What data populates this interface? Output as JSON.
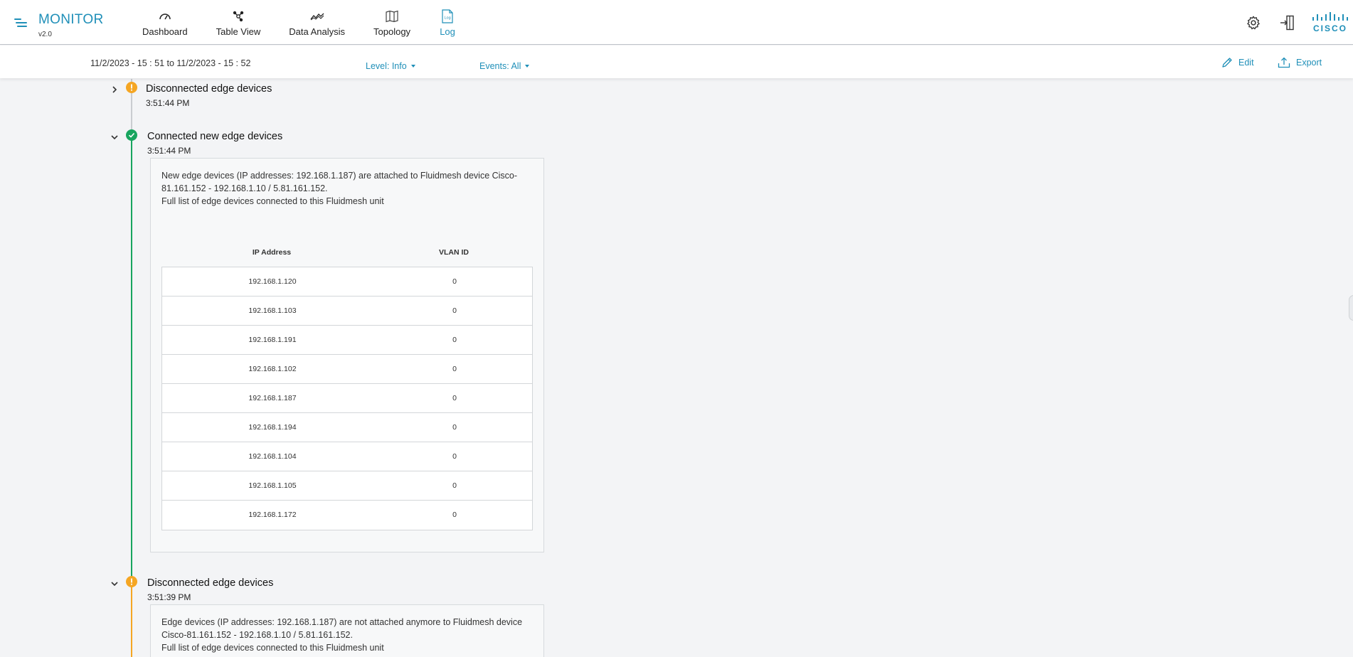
{
  "app": {
    "title": "MONITOR",
    "version": "v2.0"
  },
  "nav": [
    {
      "label": "Dashboard",
      "icon": "gauge-icon"
    },
    {
      "label": "Table View",
      "icon": "network-nodes-icon"
    },
    {
      "label": "Data Analysis",
      "icon": "line-chart-icon"
    },
    {
      "label": "Topology",
      "icon": "map-icon"
    },
    {
      "label": "Log",
      "icon": "log-file-icon",
      "active": true
    }
  ],
  "header_icons": {
    "settings": "gear-icon",
    "logout": "logout-door-icon",
    "logo_text": "CISCO"
  },
  "toolbar": {
    "date_range": "11/2/2023 - 15 : 51 to  11/2/2023 - 15 : 52",
    "level": "Level: Info",
    "events": "Events: All",
    "edit": "Edit",
    "export": "Export"
  },
  "colors": {
    "accent": "#1f8fb8",
    "warning": "#f5a623",
    "success": "#18a55f"
  },
  "events": [
    {
      "status": "warning",
      "collapsed": true,
      "title": "Disconnected edge devices",
      "time": "3:51:44 PM"
    },
    {
      "status": "success",
      "collapsed": false,
      "title": "Connected new edge devices",
      "time": "3:51:44 PM",
      "description_line1": "New edge devices (IP addresses: 192.168.1.187) are attached to Fluidmesh device Cisco-",
      "description_line2": "81.161.152 - 192.168.1.10 / 5.81.161.152.",
      "description_line3": "Full list of edge devices connected to this Fluidmesh unit",
      "table": {
        "headers": [
          "IP Address",
          "VLAN ID"
        ],
        "rows": [
          [
            "192.168.1.120",
            "0"
          ],
          [
            "192.168.1.103",
            "0"
          ],
          [
            "192.168.1.191",
            "0"
          ],
          [
            "192.168.1.102",
            "0"
          ],
          [
            "192.168.1.187",
            "0"
          ],
          [
            "192.168.1.194",
            "0"
          ],
          [
            "192.168.1.104",
            "0"
          ],
          [
            "192.168.1.105",
            "0"
          ],
          [
            "192.168.1.172",
            "0"
          ]
        ]
      }
    },
    {
      "status": "warning",
      "collapsed": false,
      "title": "Disconnected edge devices",
      "time": "3:51:39 PM",
      "description_line1": "Edge devices (IP addresses: 192.168.1.187) are not attached anymore to Fluidmesh device",
      "description_line2": "Cisco-81.161.152 - 192.168.1.10 / 5.81.161.152.",
      "description_line3": "Full list of edge devices connected to this Fluidmesh unit"
    }
  ]
}
